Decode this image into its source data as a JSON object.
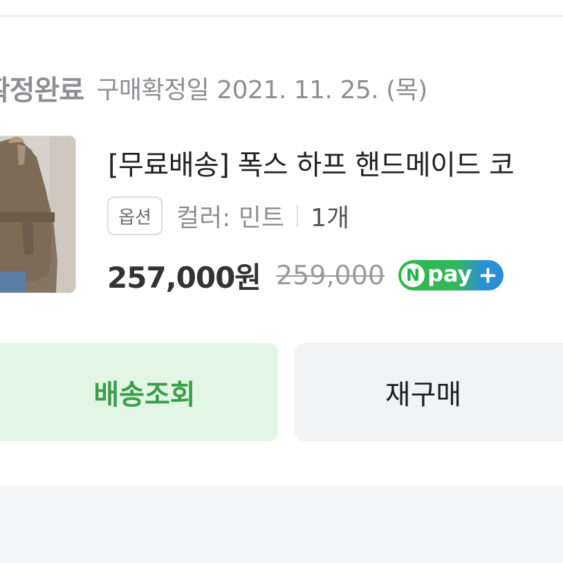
{
  "order": {
    "status": "확정완료",
    "confirm_date": "구매확정일 2021. 11. 25. (목)"
  },
  "product": {
    "name": "[무료배송] 폭스 하프 핸드메이드 코",
    "option_badge": "옵션",
    "option_value": "컬러: 민트",
    "quantity": "1개",
    "price": "257,000원",
    "original_price": "259,000",
    "npay": {
      "n": "N",
      "text": "pay",
      "plus": "+"
    }
  },
  "actions": {
    "track_label": "배송조회",
    "rebuy_label": "재구매"
  },
  "colors": {
    "track_bg": "#e3f6e4",
    "track_text": "#3a9e4a",
    "rebuy_bg": "#f1f3f5",
    "npay_green": "#2fb94a",
    "npay_blue": "#2b8fd6"
  }
}
